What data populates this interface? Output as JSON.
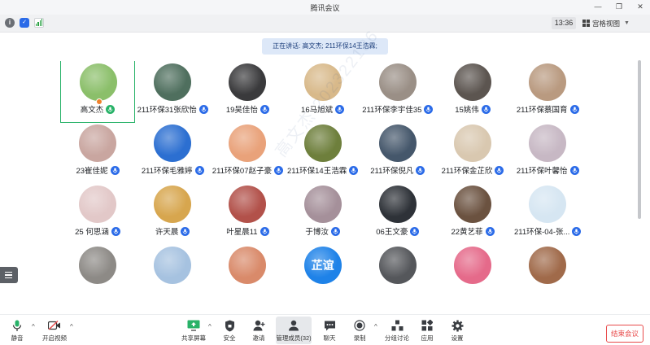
{
  "window": {
    "title": "腾讯会议"
  },
  "infobar": {
    "clock": "13:36",
    "view_mode": "宫格视图"
  },
  "speaking": {
    "text": "正在讲话: 高文杰; 211环保14王浩霖;"
  },
  "participants": [
    {
      "name": "高文杰",
      "speaking": true,
      "color": "#8bbf6a"
    },
    {
      "name": "211环保31张欣怡",
      "color": "#4f6f5e"
    },
    {
      "name": "19吴佳怡",
      "color": "#3a3a3c"
    },
    {
      "name": "16马旭斌",
      "color": "#d8b98a"
    },
    {
      "name": "211环保李宇佳35",
      "color": "#9a8f86"
    },
    {
      "name": "15姚伟",
      "color": "#5c5550"
    },
    {
      "name": "211环保蔡国育",
      "color": "#b99a80"
    },
    {
      "name": "23崔佳妮",
      "color": "#c9a6a0"
    },
    {
      "name": "211环保毛雅婷",
      "color": "#2c6fd1"
    },
    {
      "name": "211环保07赵子豪",
      "color": "#e9a27a"
    },
    {
      "name": "211环保14王浩霖",
      "color": "#6e7f3c"
    },
    {
      "name": "211环保倪凡",
      "color": "#45576b"
    },
    {
      "name": "211环保金芷欣",
      "color": "#d9c8b0"
    },
    {
      "name": "211环保叶馨怡",
      "color": "#c7b8c4"
    },
    {
      "name": "25 何思涵",
      "color": "#e2c8c8"
    },
    {
      "name": "许天晨",
      "color": "#d7a64e"
    },
    {
      "name": "叶星晨11",
      "color": "#b2514a"
    },
    {
      "name": "于博汝",
      "color": "#a5909a"
    },
    {
      "name": "06王文豪",
      "color": "#2e3238"
    },
    {
      "name": "22黄艺菲",
      "color": "#6b5240"
    },
    {
      "name": "211环保-04-张...",
      "color": "#d6e6f2"
    },
    {
      "name": "",
      "color": "#8d8a86"
    },
    {
      "name": "",
      "color": "#a6c2e0"
    },
    {
      "name": "",
      "color": "#d98a6a"
    },
    {
      "name": "",
      "avatar_text": "芷谊",
      "color": "#1e82e8"
    },
    {
      "name": "",
      "color": "#55575b"
    },
    {
      "name": "",
      "color": "#e56a8a"
    },
    {
      "name": "",
      "color": "#a06a4a"
    }
  ],
  "watermark": "高文杰 202322186",
  "toolbar": {
    "mute": "静音",
    "video": "开启视频",
    "share": "共享屏幕",
    "security": "安全",
    "invite": "邀请",
    "members": "管理成员(32)",
    "chat": "聊天",
    "record": "录制",
    "breakout": "分组讨论",
    "apps": "应用",
    "settings": "设置",
    "end": "结束会议"
  }
}
